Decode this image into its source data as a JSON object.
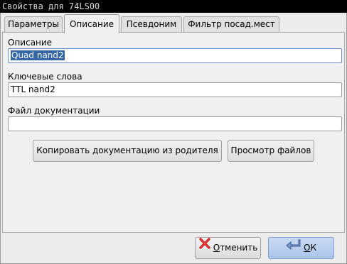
{
  "window": {
    "title": "Свойства для 74LS00"
  },
  "tabs": [
    {
      "label": "Параметры"
    },
    {
      "label": "Описание"
    },
    {
      "label": "Псевдоним"
    },
    {
      "label": "Фильтр посад.мест"
    }
  ],
  "form": {
    "description_label": "Описание",
    "description_value": "Quad nand2",
    "keywords_label": "Ключевые слова",
    "keywords_value": "TTL nand2",
    "docfile_label": "Файл документации",
    "docfile_value": ""
  },
  "actions": {
    "copy_doc_label": "Копировать документацию из родителя",
    "view_files_label": "Просмотр файлов"
  },
  "footer": {
    "cancel_first": "О",
    "cancel_rest": "тменить",
    "ok_first": "О",
    "ok_rest": "К"
  },
  "icons": {
    "cancel": "red-x-icon",
    "ok": "return-arrow-icon"
  }
}
